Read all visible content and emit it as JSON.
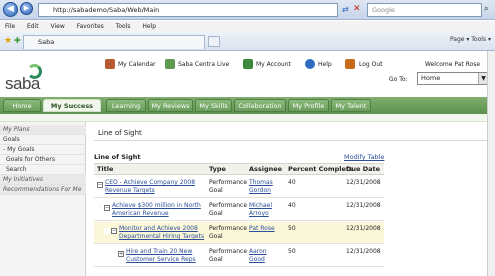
{
  "browser": {
    "url": "http://sabademo/Saba/Web/Main",
    "search_placeholder": "Google",
    "menu": [
      "File",
      "Edit",
      "View",
      "Favorites",
      "Tools",
      "Help"
    ],
    "tab_title": "Saba",
    "toolbar_right": "Page ▾  Tools ▾"
  },
  "header": {
    "logo": "saba",
    "links": [
      "My Calendar",
      "Saba Centra Live",
      "My Account",
      "Help",
      "Log Out"
    ],
    "welcome": "Welcome Pat Rose",
    "goto_label": "Go To:",
    "goto_value": "Home"
  },
  "nav_tabs": [
    "Home",
    "My Success Plan",
    "Learning",
    "My Reviews",
    "My Skills",
    "Collaboration",
    "My Profile",
    "My Talent"
  ],
  "sidebar": {
    "items": [
      {
        "label": "My Plans",
        "head": true
      },
      {
        "label": "Goals",
        "head": false
      },
      {
        "label": "- My Goals",
        "head": false
      },
      {
        "label": "Goals for Others",
        "head": false
      },
      {
        "label": "Search",
        "head": false
      },
      {
        "label": "My Initiatives",
        "head": true
      },
      {
        "label": "Recommendations For Me",
        "head": true
      }
    ]
  },
  "main": {
    "page_title": "Line of Sight",
    "section_label": "Line of Sight",
    "modify_label": "Modify Table",
    "columns": [
      "Title",
      "Type",
      "Assignee",
      "Percent Complete",
      "Due Date"
    ],
    "rows": [
      {
        "title1": "CEO - Achieve Company 2008",
        "title2": "Revenue Targets",
        "type1": "Performance",
        "type2": "Goal",
        "assignee1": "Thomas",
        "assignee2": "Gordon",
        "percent": "40",
        "due": "12/31/2008"
      },
      {
        "title1": "Achieve $300 million in North",
        "title2": "American Revenue",
        "type1": "Performance",
        "type2": "Goal",
        "assignee1": "Michael",
        "assignee2": "Arroyo",
        "percent": "40",
        "due": "12/31/2008"
      },
      {
        "title1": "Monitor and Achieve 2008",
        "title2": "Departmental Hiring Targets",
        "type1": "Performance",
        "type2": "Goal",
        "assignee1": "Pat Rose",
        "assignee2": "",
        "percent": "50",
        "due": "12/31/2008"
      },
      {
        "title1": "Hire and Train 20 New",
        "title2": "Customer Service Reps",
        "type1": "Performance",
        "type2": "Goal",
        "assignee1": "Aaron",
        "assignee2": "Good",
        "percent": "50",
        "due": "12/31/2008"
      }
    ]
  }
}
